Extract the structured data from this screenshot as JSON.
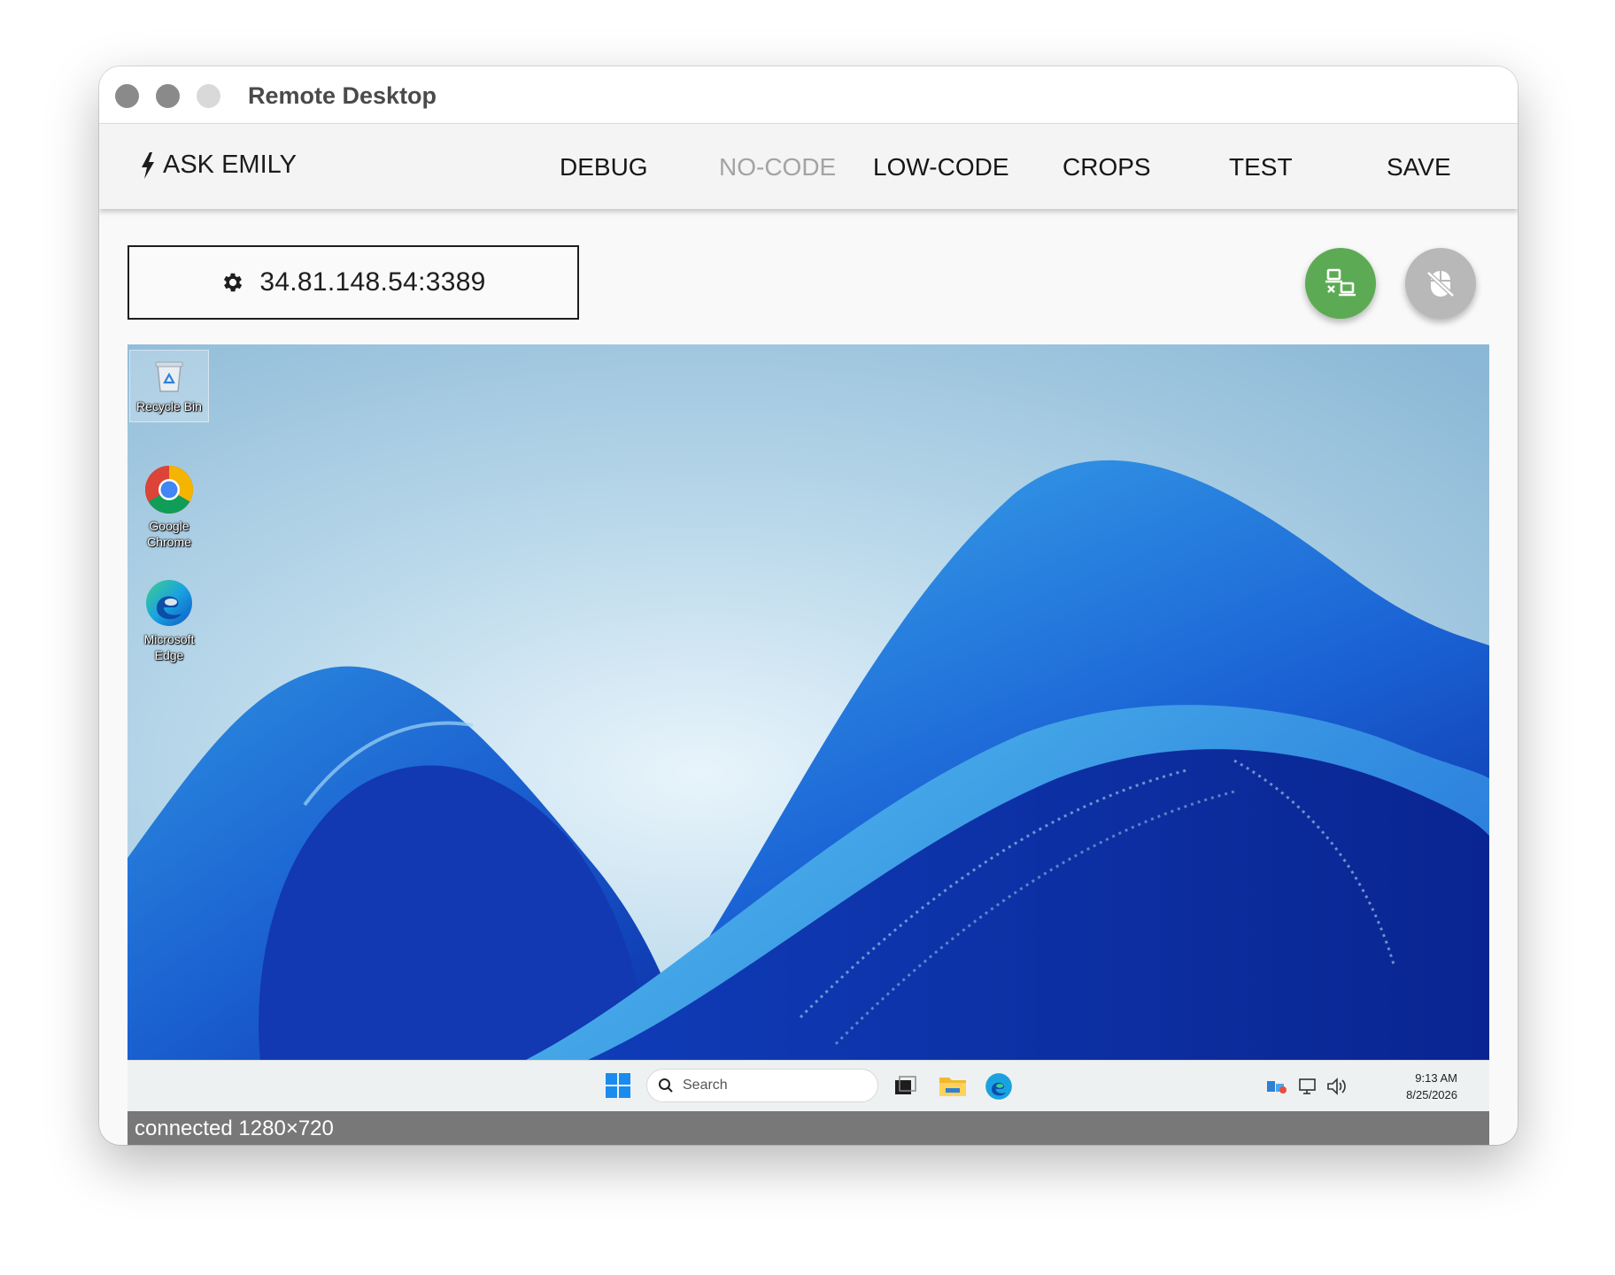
{
  "window": {
    "title": "Remote Desktop"
  },
  "toolbar": {
    "ask_label": "ASK EMILY",
    "menu": [
      {
        "label": "DEBUG",
        "enabled": true
      },
      {
        "label": "NO-CODE",
        "enabled": false
      },
      {
        "label": "LOW-CODE",
        "enabled": true
      },
      {
        "label": "CROPS",
        "enabled": true
      },
      {
        "label": "TEST",
        "enabled": true
      },
      {
        "label": "SAVE",
        "enabled": true
      }
    ]
  },
  "connection": {
    "address": "34.81.148.54:3389",
    "icon": "gear-icon"
  },
  "actions": {
    "disconnect_icon": "network-disconnect-icon",
    "disconnect_color": "#5cab54",
    "mouse_icon": "mouse-off-icon",
    "mouse_color": "#b8b8b8"
  },
  "remote_desktop": {
    "icons": [
      {
        "label_line1": "Recycle Bin",
        "label_line2": "",
        "icon": "recycle-bin-icon"
      },
      {
        "label_line1": "Google",
        "label_line2": "Chrome",
        "icon": "chrome-icon"
      },
      {
        "label_line1": "Microsoft",
        "label_line2": "Edge",
        "icon": "edge-icon"
      }
    ],
    "taskbar": {
      "search_placeholder": "Search",
      "time": "9:13 AM",
      "date": "8/25/2026"
    }
  },
  "status": {
    "text": "connected 1280×720"
  }
}
